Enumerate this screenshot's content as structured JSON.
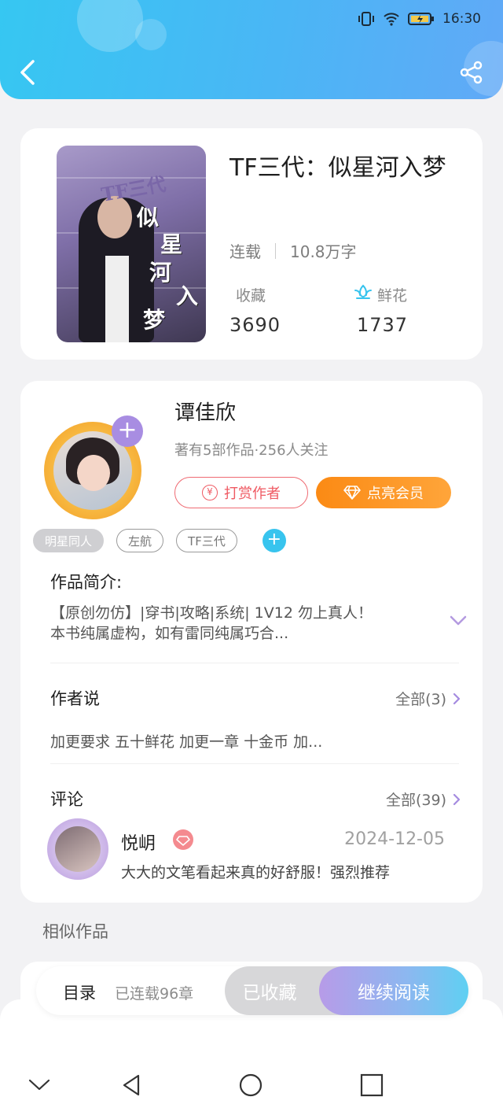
{
  "status_bar": {
    "time": "16:30"
  },
  "book": {
    "title": "TF三代：似星河入梦",
    "status": "连载",
    "word_count": "10.8万字",
    "collect_label": "收藏",
    "collect_count": "3690",
    "flower_label": "鲜花",
    "flower_count": "1737",
    "cover_title": "TF三代",
    "cover_chars": [
      "似",
      "星",
      "河",
      "入",
      "梦"
    ]
  },
  "author": {
    "name": "谭佳欣",
    "subtitle": "著有5部作品·256人关注",
    "tip_label": "打赏作者",
    "vip_label": "点亮会员",
    "coin_symbol": "¥"
  },
  "tags": [
    "明星同人",
    "左航",
    "TF三代"
  ],
  "intro": {
    "title": "作品简介:",
    "line1": "【原创勿仿】|穿书|攻略|系统|  1V12  勿上真人！",
    "line2": "本书纯属虚构，如有雷同纯属巧合..."
  },
  "author_says": {
    "title": "作者说",
    "all_label": "全部(3)",
    "text": "加更要求 五十鲜花   加更一章 十金币   加..."
  },
  "comments": {
    "title": "评论",
    "all_label": "全部(39)",
    "first": {
      "user": "悦岄",
      "date": "2024-12-05",
      "text": "大大的文笔看起来真的好舒服！强烈推荐"
    }
  },
  "similar": {
    "title": "相似作品"
  },
  "action_bar": {
    "catalog_label": "目录",
    "chapter_count": "已连载96章",
    "collected_label": "已收藏",
    "read_label": "继续阅读"
  },
  "colors": {
    "header_gradient_start": "#36c7f2",
    "header_gradient_end": "#61a9f7",
    "vip_orange": "#fb8a14",
    "tip_red": "#ef5a63",
    "accent_purple": "#a88de2"
  }
}
